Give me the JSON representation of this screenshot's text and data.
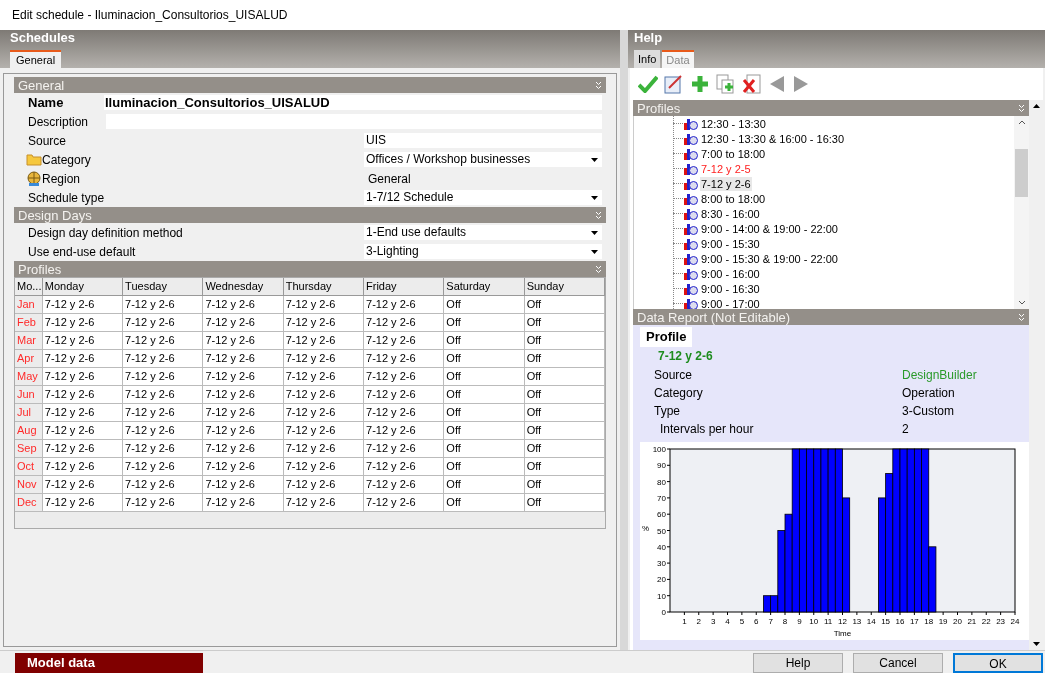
{
  "window": {
    "title": "Edit schedule - Iluminacion_Consultorios_UISALUD"
  },
  "schedules": {
    "title": "Schedules",
    "tabs": [
      {
        "label": "General",
        "selected": true
      }
    ],
    "general": {
      "title": "General",
      "fields": [
        {
          "label": "Name",
          "value": "Iluminacion_Consultorios_UISALUD",
          "kind": "name"
        },
        {
          "label": "Description",
          "kind": "description"
        },
        {
          "label": "Source",
          "value": "UIS",
          "kind": "text"
        },
        {
          "label": "Category",
          "value": "Offices / Workshop businesses",
          "kind": "folder"
        },
        {
          "label": "Region",
          "value": "General",
          "kind": "region"
        },
        {
          "label": "Schedule type",
          "value": "1-7/12 Schedule",
          "kind": "dropdown"
        }
      ]
    },
    "design_days": {
      "title": "Design Days",
      "fields": [
        {
          "label": "Design day definition method",
          "value": "1-End use defaults",
          "kind": "dropdown"
        },
        {
          "label": "Use end-use default",
          "value": "3-Lighting",
          "kind": "dropdown"
        }
      ]
    },
    "profiles": {
      "title": "Profiles",
      "columns": [
        "Mo...",
        "Monday",
        "Tuesday",
        "Wednesday",
        "Thursday",
        "Friday",
        "Saturday",
        "Sunday"
      ],
      "rows": [
        [
          "Jan",
          "7-12 y 2-6",
          "7-12 y 2-6",
          "7-12 y 2-6",
          "7-12 y 2-6",
          "7-12 y 2-6",
          "Off",
          "Off"
        ],
        [
          "Feb",
          "7-12 y 2-6",
          "7-12 y 2-6",
          "7-12 y 2-6",
          "7-12 y 2-6",
          "7-12 y 2-6",
          "Off",
          "Off"
        ],
        [
          "Mar",
          "7-12 y 2-6",
          "7-12 y 2-6",
          "7-12 y 2-6",
          "7-12 y 2-6",
          "7-12 y 2-6",
          "Off",
          "Off"
        ],
        [
          "Apr",
          "7-12 y 2-6",
          "7-12 y 2-6",
          "7-12 y 2-6",
          "7-12 y 2-6",
          "7-12 y 2-6",
          "Off",
          "Off"
        ],
        [
          "May",
          "7-12 y 2-6",
          "7-12 y 2-6",
          "7-12 y 2-6",
          "7-12 y 2-6",
          "7-12 y 2-6",
          "Off",
          "Off"
        ],
        [
          "Jun",
          "7-12 y 2-6",
          "7-12 y 2-6",
          "7-12 y 2-6",
          "7-12 y 2-6",
          "7-12 y 2-6",
          "Off",
          "Off"
        ],
        [
          "Jul",
          "7-12 y 2-6",
          "7-12 y 2-6",
          "7-12 y 2-6",
          "7-12 y 2-6",
          "7-12 y 2-6",
          "Off",
          "Off"
        ],
        [
          "Aug",
          "7-12 y 2-6",
          "7-12 y 2-6",
          "7-12 y 2-6",
          "7-12 y 2-6",
          "7-12 y 2-6",
          "Off",
          "Off"
        ],
        [
          "Sep",
          "7-12 y 2-6",
          "7-12 y 2-6",
          "7-12 y 2-6",
          "7-12 y 2-6",
          "7-12 y 2-6",
          "Off",
          "Off"
        ],
        [
          "Oct",
          "7-12 y 2-6",
          "7-12 y 2-6",
          "7-12 y 2-6",
          "7-12 y 2-6",
          "7-12 y 2-6",
          "Off",
          "Off"
        ],
        [
          "Nov",
          "7-12 y 2-6",
          "7-12 y 2-6",
          "7-12 y 2-6",
          "7-12 y 2-6",
          "7-12 y 2-6",
          "Off",
          "Off"
        ],
        [
          "Dec",
          "7-12 y 2-6",
          "7-12 y 2-6",
          "7-12 y 2-6",
          "7-12 y 2-6",
          "7-12 y 2-6",
          "Off",
          "Off"
        ]
      ]
    }
  },
  "help": {
    "title": "Help",
    "tabs": [
      {
        "label": "Info",
        "selected": false
      },
      {
        "label": "Data",
        "selected": true
      }
    ],
    "profiles": {
      "title": "Profiles",
      "items": [
        {
          "label": "12:30 - 13:30",
          "flagged": false,
          "selected": false
        },
        {
          "label": "12:30 - 13:30 & 16:00 - 16:30",
          "flagged": false,
          "selected": false
        },
        {
          "label": "7:00 to 18:00",
          "flagged": false,
          "selected": false
        },
        {
          "label": "7-12 y 2-5",
          "flagged": true,
          "selected": false
        },
        {
          "label": "7-12 y 2-6",
          "flagged": false,
          "selected": true
        },
        {
          "label": "8:00 to 18:00",
          "flagged": false,
          "selected": false
        },
        {
          "label": "8:30 - 16:00",
          "flagged": false,
          "selected": false
        },
        {
          "label": "9:00 - 14:00 & 19:00 - 22:00",
          "flagged": false,
          "selected": false
        },
        {
          "label": "9:00 - 15:30",
          "flagged": false,
          "selected": false
        },
        {
          "label": "9:00 - 15:30 & 19:00 - 22:00",
          "flagged": false,
          "selected": false
        },
        {
          "label": "9:00 - 16:00",
          "flagged": false,
          "selected": false
        },
        {
          "label": "9:00 - 16:30",
          "flagged": false,
          "selected": false
        },
        {
          "label": "9:00 - 17:00",
          "flagged": false,
          "selected": false
        }
      ]
    },
    "report": {
      "title": "Data Report (Not Editable)",
      "tab": "Profile",
      "name": "7-12 y 2-6",
      "rows": [
        {
          "label": "Source",
          "value": "DesignBuilder",
          "kind": "link"
        },
        {
          "label": "Category",
          "value": "Operation",
          "kind": "plain"
        },
        {
          "label": "Type",
          "value": "3-Custom",
          "kind": "plain"
        },
        {
          "label": "Intervals per hour",
          "value": "2",
          "kind": "sub"
        }
      ],
      "chart_data": {
        "type": "bar",
        "xlabel": "Time",
        "ylabel": "%",
        "x": [
          0.25,
          0.75,
          1.25,
          1.75,
          2.25,
          2.75,
          3.25,
          3.75,
          4.25,
          4.75,
          5.25,
          5.75,
          6.25,
          6.75,
          7.25,
          7.75,
          8.25,
          8.75,
          9.25,
          9.75,
          10.25,
          10.75,
          11.25,
          11.75,
          12.25,
          12.75,
          13.25,
          13.75,
          14.25,
          14.75,
          15.25,
          15.75,
          16.25,
          16.75,
          17.25,
          17.75,
          18.25,
          18.75,
          19.25,
          19.75,
          20.25,
          20.75,
          21.25,
          21.75,
          22.25,
          22.75,
          23.25,
          23.75
        ],
        "values": [
          0,
          0,
          0,
          0,
          0,
          0,
          0,
          0,
          0,
          0,
          0,
          0,
          0,
          10,
          10,
          50,
          60,
          100,
          100,
          100,
          100,
          100,
          100,
          100,
          70,
          0,
          0,
          0,
          0,
          70,
          85,
          100,
          100,
          100,
          100,
          100,
          40,
          0,
          0,
          0,
          0,
          0,
          0,
          0,
          0,
          0,
          0,
          0
        ],
        "xlim": [
          0,
          24
        ],
        "ylim": [
          0,
          100
        ],
        "xticks": [
          1,
          2,
          3,
          4,
          5,
          6,
          7,
          8,
          9,
          10,
          11,
          12,
          13,
          14,
          15,
          16,
          17,
          18,
          19,
          20,
          21,
          22,
          23,
          24
        ],
        "yticks": [
          0,
          10,
          20,
          30,
          40,
          50,
          60,
          70,
          80,
          90,
          100
        ]
      }
    }
  },
  "footer": {
    "model_data": "Model data",
    "buttons": [
      {
        "label": "Help",
        "default": false
      },
      {
        "label": "Cancel",
        "default": false
      },
      {
        "label": "OK",
        "default": true
      }
    ]
  }
}
